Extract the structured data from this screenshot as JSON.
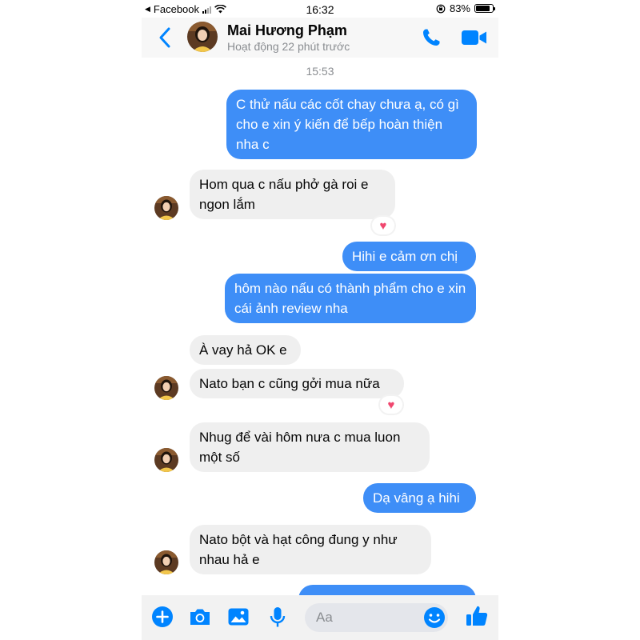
{
  "status_bar": {
    "back_app": "Facebook",
    "time": "16:32",
    "battery": "83%",
    "battery_level": 0.83
  },
  "header": {
    "contact_name": "Mai Hương Phạm",
    "contact_status": "Hoạt động 22 phút trước"
  },
  "conversation": {
    "timestamp": "15:53",
    "messages": [
      {
        "from": "me",
        "text": "C thử nấu các cốt chay chưa ạ, có gì cho e xin ý kiến để bếp hoàn thiện nha c"
      },
      {
        "from": "contact",
        "text": "Hom qua c nấu phở gà roi e ngon lắm",
        "reaction": "heart"
      },
      {
        "from": "me",
        "text": "Hihi e cảm ơn chị"
      },
      {
        "from": "me",
        "text": "hôm nào nấu có thành phẩm cho e xin cái ảnh review nha"
      },
      {
        "from": "contact",
        "text": "À vay hả OK e"
      },
      {
        "from": "contact",
        "text": "Nato bạn c cũng gởi mua nữa",
        "reaction": "heart"
      },
      {
        "from": "contact",
        "text": "Nhug để vài hôm nưa c mua luon một số"
      },
      {
        "from": "me",
        "text": "Dạ vâng ạ hihi"
      },
      {
        "from": "contact",
        "text": "Nato bột và hạt công đung y như nhau hả e"
      },
      {
        "from": "me",
        "text": ""
      }
    ]
  },
  "composer": {
    "placeholder": "Aa",
    "icons": [
      "plus-icon",
      "camera-icon",
      "photo-icon",
      "microphone-icon",
      "emoji-icon",
      "like-icon"
    ]
  },
  "colors": {
    "accent": "#0084ff",
    "outgoing_bubble": "#3e8ef7",
    "incoming_bubble": "#efefef",
    "reaction_heart": "#f0466e",
    "muted_text": "#8a8d91"
  }
}
